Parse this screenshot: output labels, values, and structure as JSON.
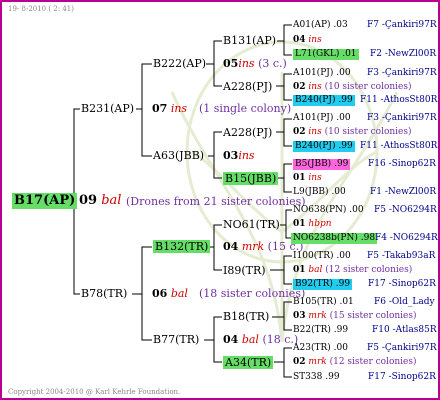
{
  "header": {
    "date": "19-  8-2010  (  2: 41)"
  },
  "footer": {
    "copyright": "Copyright 2004-2010 @ Karl Kehrle Foundation."
  },
  "root": {
    "name": "B17(AP)",
    "gen": "09",
    "queen": "bal",
    "note": "(Drones from 21 sister colonies)"
  },
  "g1": {
    "sire": {
      "name": "B231(AP)",
      "gen": "07",
      "queen": "ins",
      "note": "(1 single colony)"
    },
    "dam": {
      "name": "B78(TR)",
      "gen": "06",
      "queen": "bal",
      "note": "(18 sister colonies)"
    }
  },
  "g2": {
    "b222": {
      "name": "B222(AP)",
      "gen": "05",
      "queen": "ins",
      "note": "(3 c.)"
    },
    "a63": {
      "name": "A63(JBB)",
      "gen": "03",
      "queen": "ins",
      "note": ""
    },
    "b132": {
      "name": "B132(TR)",
      "gen": "04",
      "queen": "mrk",
      "note": "(15 c.)"
    },
    "b77": {
      "name": "B77(TR)",
      "gen": "04",
      "queen": "bal",
      "note": "(18 c.)"
    }
  },
  "g3": {
    "b131": "B131(AP)",
    "a228a": "A228(PJ)",
    "a228b": "A228(PJ)",
    "b15": "B15(JBB)",
    "no61": "NO61(TR)",
    "i89": "I89(TR)",
    "b18": "B18(TR)",
    "a34": "A34(TR)"
  },
  "g4": [
    {
      "name": "A01(AP)",
      "mid": ".03",
      "right": "F7 -Çankiri97R"
    },
    {
      "name": "04",
      "mid": "ins",
      "right": ""
    },
    {
      "name": "L71(GKL)",
      "mid": ".01",
      "right": "F2 -NewZl00R"
    },
    {
      "name": "A101(PJ)",
      "mid": ".00",
      "right": "F3 -Çankiri97R"
    },
    {
      "name": "02",
      "mid": "ins",
      "right": "(10 sister colonies)"
    },
    {
      "name": "B240(PJ)",
      "mid": ".99",
      "right": "F11 -AthosSt80R"
    },
    {
      "name": "A101(PJ)",
      "mid": ".00",
      "right": "F3 -Çankiri97R"
    },
    {
      "name": "02",
      "mid": "ins",
      "right": "(10 sister colonies)"
    },
    {
      "name": "B240(PJ)",
      "mid": ".99",
      "right": "F11 -AthosSt80R"
    },
    {
      "name": "B5(JBB)",
      "mid": ".99",
      "right": "F16 -Sinop62R"
    },
    {
      "name": "01",
      "mid": "ins",
      "right": ""
    },
    {
      "name": "L9(JBB)",
      "mid": ".00",
      "right": "F1 -NewZl00R"
    },
    {
      "name": "NO638(PN)",
      "mid": ".00",
      "right": "F5 -NO6294R"
    },
    {
      "name": "01",
      "mid": "hbpn",
      "right": ""
    },
    {
      "name": "NO6238b(PN)",
      "mid": ".98",
      "right": "F4 -NO6294R"
    },
    {
      "name": "I100(TR)",
      "mid": ".00",
      "right": "F5 -Takab93aR"
    },
    {
      "name": "01",
      "mid": "bal",
      "right": "(12 sister colonies)"
    },
    {
      "name": "B92(TR)",
      "mid": ".99",
      "right": "F17 -Sinop62R"
    },
    {
      "name": "B105(TR)",
      "mid": ".01",
      "right": "F6 -Old_Lady"
    },
    {
      "name": "03",
      "mid": "mrk",
      "right": "(15 sister colonies)"
    },
    {
      "name": "B22(TR)",
      "mid": ".99",
      "right": "F10 -Atlas85R"
    },
    {
      "name": "A23(TR)",
      "mid": ".00",
      "right": "F5 -Çankiri97R"
    },
    {
      "name": "02",
      "mid": "mrk",
      "right": "(12 sister colonies)"
    },
    {
      "name": "ST338",
      "mid": ".99",
      "right": "F17 -Sinop62R"
    }
  ],
  "colors": {
    "frame": "#b8008e",
    "green": "#66dd66",
    "cyan": "#22ccee",
    "pink": "#ff66dd",
    "purple": "#7030a0",
    "blue": "#00008b",
    "red": "#d00000"
  }
}
